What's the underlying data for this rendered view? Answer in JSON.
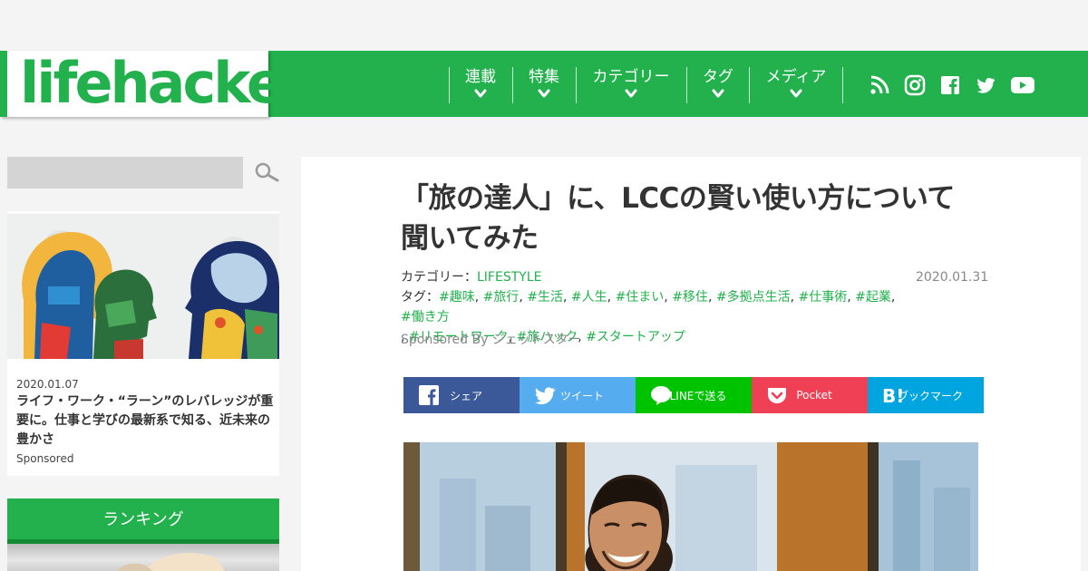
{
  "brand": {
    "logo_text": "lifehacker",
    "color": "#22b14c"
  },
  "nav": {
    "items": [
      {
        "label": "連載"
      },
      {
        "label": "特集"
      },
      {
        "label": "カテゴリー"
      },
      {
        "label": "タグ"
      },
      {
        "label": "メディア"
      }
    ],
    "social": [
      "rss-icon",
      "instagram-icon",
      "facebook-icon",
      "twitter-icon",
      "youtube-icon"
    ]
  },
  "search": {
    "placeholder": ""
  },
  "sidebar": {
    "card": {
      "date": "2020.01.07",
      "title": "ライフ・ワーク・“ラーン”のレバレッジが重要に。仕事と学びの最新系で知る、近未来の豊かさ",
      "sponsored": "Sponsored"
    },
    "ranking_label": "ランキング"
  },
  "article": {
    "title": "「旅の達人」に、LCCの賢い使い方について聞いてみた",
    "category_label": "カテゴリー：",
    "category": "LIFESTYLE",
    "date": "2020.01.31",
    "tags_label": "タグ：",
    "tags": [
      "#趣味",
      "#旅行",
      "#生活",
      "#人生",
      "#住まい",
      "#移住",
      "#多拠点生活",
      "#仕事術",
      "#起業",
      "#働き方",
      "#リモートワーク",
      "#旅ハック",
      "#スタートアップ"
    ],
    "sponsored_by": "Sponsored By ジェットスター"
  },
  "share": {
    "buttons": [
      {
        "label": "シェア",
        "color": "#3b5998",
        "icon": "facebook-icon"
      },
      {
        "label": "ツイート",
        "color": "#55acee",
        "icon": "twitter-icon"
      },
      {
        "label": "LINEで送る",
        "color": "#00c300",
        "icon": "line-icon"
      },
      {
        "label": "Pocket",
        "color": "#ef4056",
        "icon": "pocket-icon"
      },
      {
        "label": "ブックマーク",
        "color": "#00a4de",
        "icon": "hatena-bookmark-icon"
      }
    ]
  }
}
